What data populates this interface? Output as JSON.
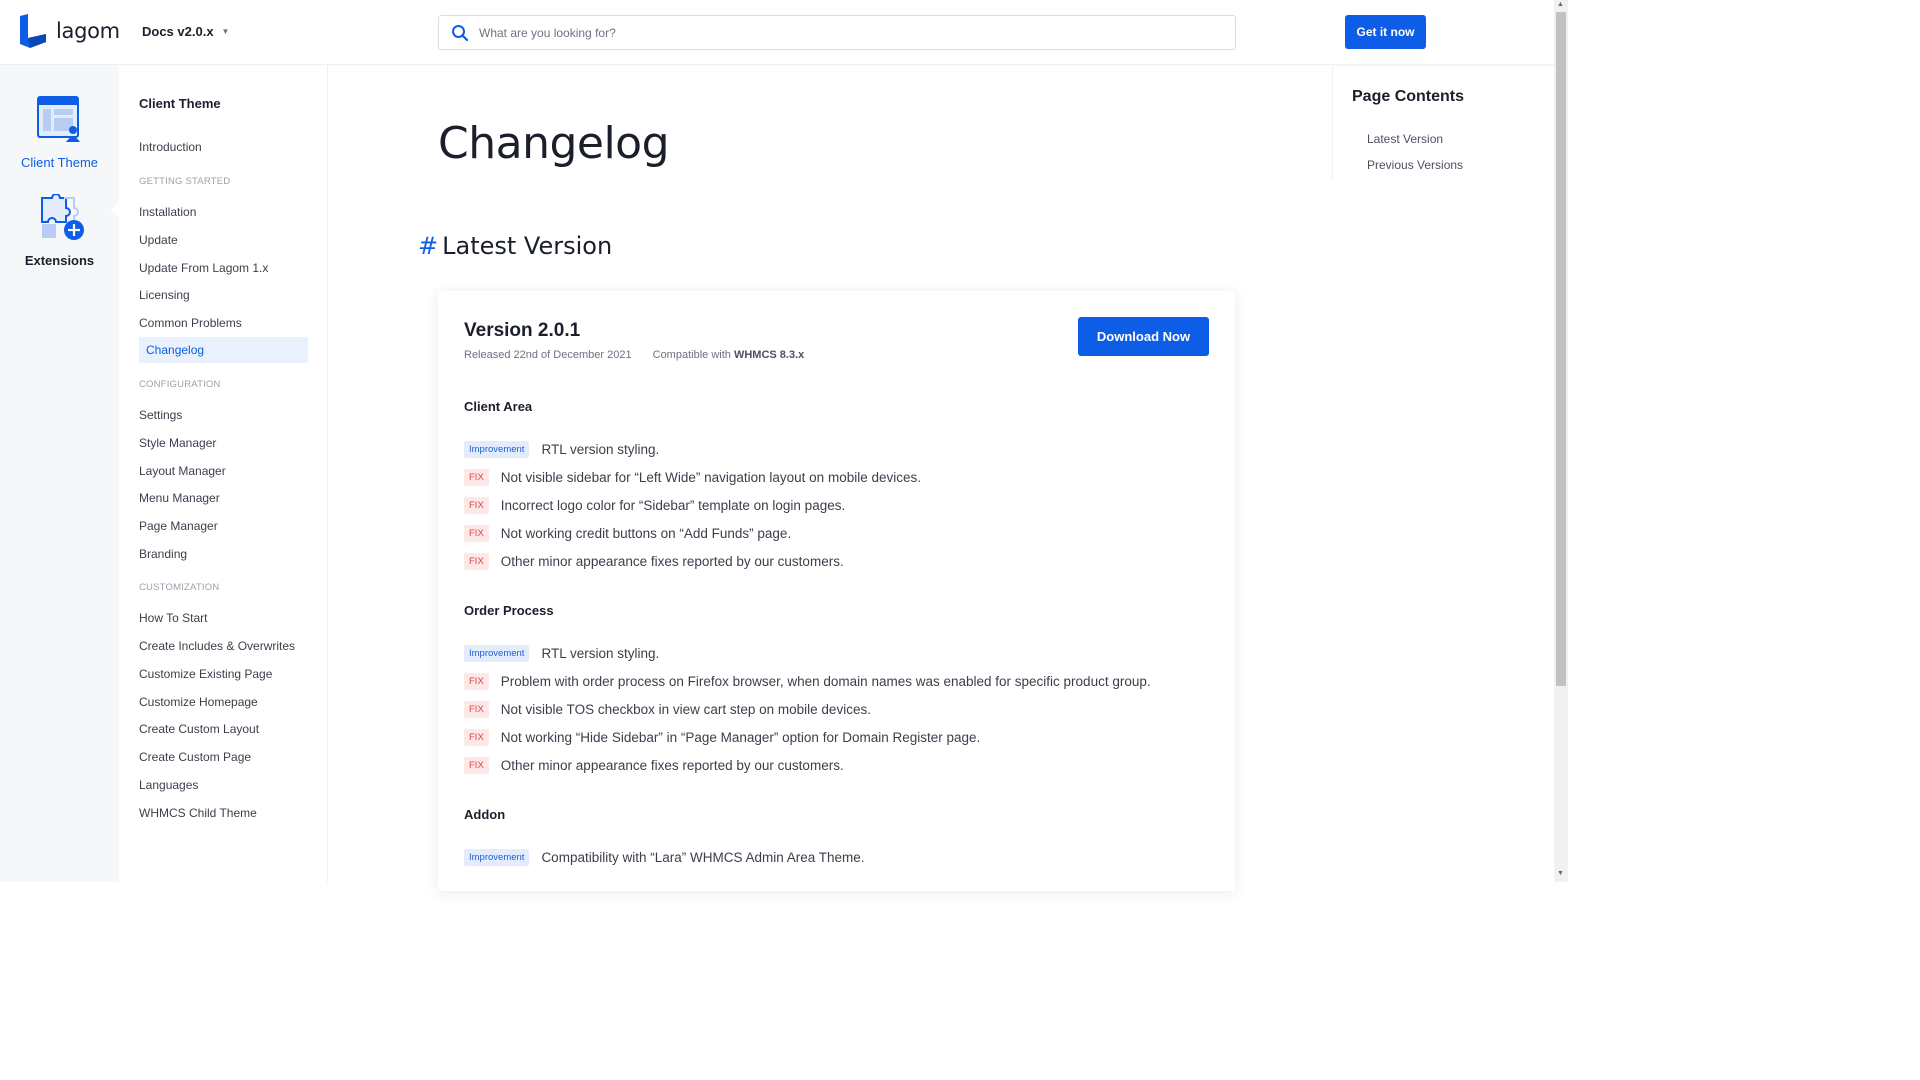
{
  "header": {
    "logo_text": "lagom",
    "docs_version": "Docs v2.0.x",
    "search_placeholder": "What are you looking for?",
    "cta_label": "Get it now"
  },
  "rail": {
    "items": [
      {
        "label": "Client Theme",
        "icon": "client-theme-icon",
        "active": true
      },
      {
        "label": "Extensions",
        "icon": "extensions-icon",
        "active": false
      }
    ]
  },
  "sidebar": {
    "title": "Client Theme",
    "intro": "Introduction",
    "sections": [
      {
        "heading": "GETTING STARTED",
        "items": [
          "Installation",
          "Update",
          "Update From Lagom 1.x",
          "Licensing",
          "Common Problems",
          "Changelog"
        ]
      },
      {
        "heading": "CONFIGURATION",
        "items": [
          "Settings",
          "Style Manager",
          "Layout Manager",
          "Menu Manager",
          "Page Manager",
          "Branding"
        ]
      },
      {
        "heading": "CUSTOMIZATION",
        "items": [
          "How To Start",
          "Create Includes & Overwrites",
          "Customize Existing Page",
          "Customize Homepage",
          "Create Custom Layout",
          "Create Custom Page",
          "Languages",
          "WHMCS Child Theme"
        ]
      }
    ],
    "active_item": "Changelog"
  },
  "main": {
    "page_title": "Changelog",
    "section_hash": "#",
    "section_title": "Latest Version",
    "version": {
      "title": "Version 2.0.1",
      "released": "Released 22nd of December 2021",
      "compat_prefix": "Compatible with",
      "compat_value": "WHMCS 8.3.x",
      "download_label": "Download Now"
    },
    "groups": [
      {
        "title": "Client Area",
        "entries": [
          {
            "tag": "Improvement",
            "text": "RTL version styling."
          },
          {
            "tag": "FIX",
            "text": "Not visible sidebar for “Left Wide” navigation layout on mobile devices."
          },
          {
            "tag": "FIX",
            "text": "Incorrect logo color for “Sidebar” template on login pages."
          },
          {
            "tag": "FIX",
            "text": "Not working credit buttons on “Add Funds” page."
          },
          {
            "tag": "FIX",
            "text": "Other minor appearance fixes reported by our customers."
          }
        ]
      },
      {
        "title": "Order Process",
        "entries": [
          {
            "tag": "Improvement",
            "text": "RTL version styling."
          },
          {
            "tag": "FIX",
            "text": "Problem with order process on Firefox browser, when domain names was enabled for specific product group."
          },
          {
            "tag": "FIX",
            "text": "Not visible TOS checkbox in view cart step on mobile devices."
          },
          {
            "tag": "FIX",
            "text": "Not working “Hide Sidebar” in “Page Manager” option for Domain Register page."
          },
          {
            "tag": "FIX",
            "text": "Other minor appearance fixes reported by our customers."
          }
        ]
      },
      {
        "title": "Addon",
        "entries": [
          {
            "tag": "Improvement",
            "text": "Compatibility with “Lara” WHMCS Admin Area Theme."
          }
        ]
      }
    ]
  },
  "toc": {
    "title": "Page Contents",
    "links": [
      "Latest Version",
      "Previous Versions"
    ]
  },
  "colors": {
    "accent": "#0e5de7",
    "improvement_bg": "#e3ecfb",
    "fix_bg": "#fde8e8",
    "fix_text": "#d64545"
  }
}
